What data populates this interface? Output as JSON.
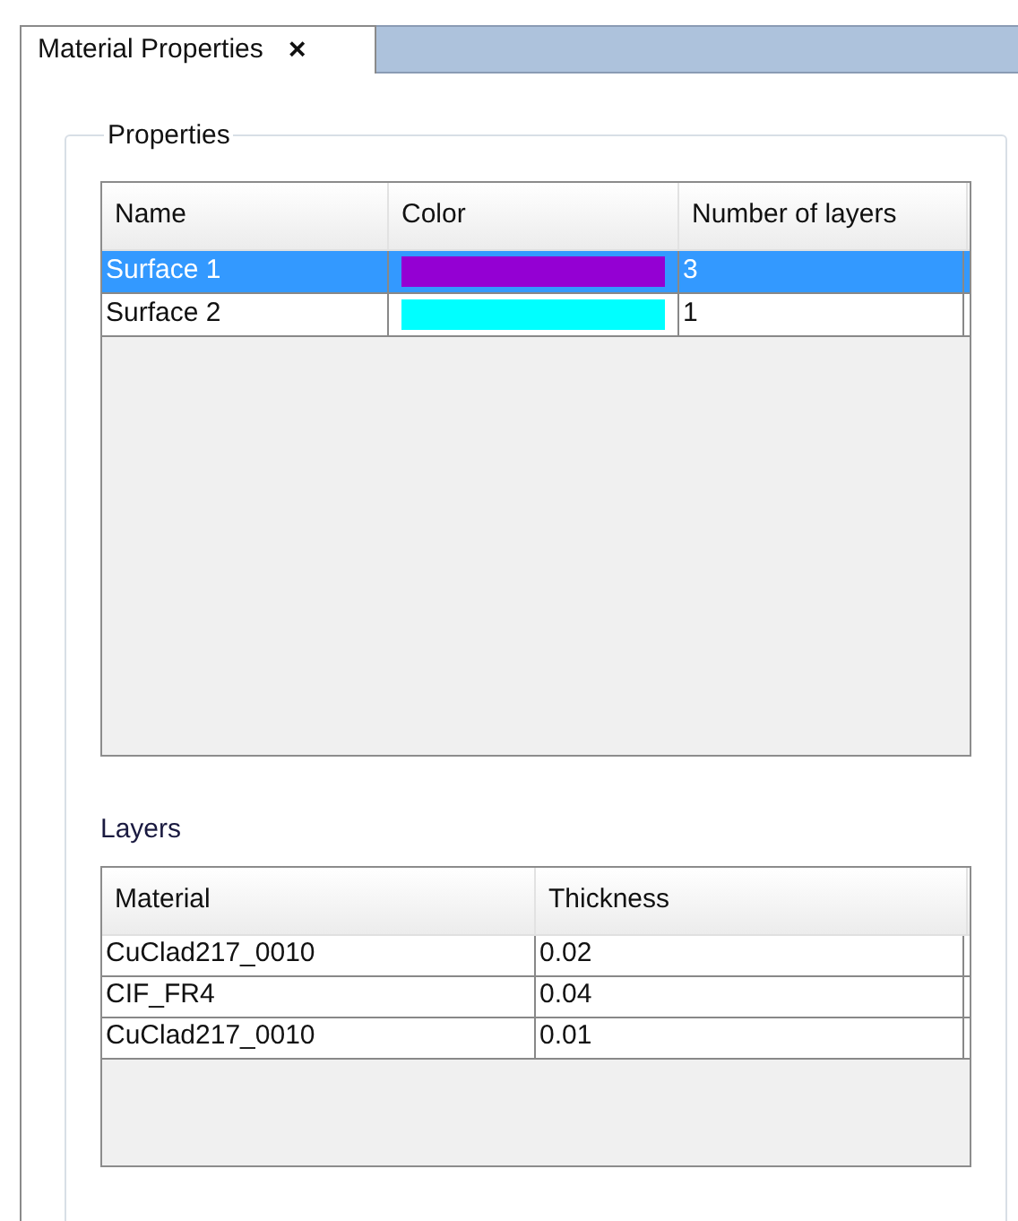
{
  "tabs": [
    {
      "label": "Material Properties",
      "close": "×",
      "selected": true
    }
  ],
  "properties": {
    "title": "Properties",
    "columns": [
      "Name",
      "Color",
      "Number of layers"
    ],
    "rows": [
      {
        "name": "Surface 1",
        "color": "#9400d3",
        "layers": "3",
        "selected": true
      },
      {
        "name": "Surface 2",
        "color": "#00ffff",
        "layers": "1",
        "selected": false
      }
    ]
  },
  "layers": {
    "title": "Layers",
    "columns": [
      "Material",
      "Thickness"
    ],
    "rows": [
      {
        "material": "CuClad217_0010",
        "thickness": "0.02"
      },
      {
        "material": "CIF_FR4",
        "thickness": "0.04"
      },
      {
        "material": "CuClad217_0010",
        "thickness": "0.01"
      }
    ]
  }
}
